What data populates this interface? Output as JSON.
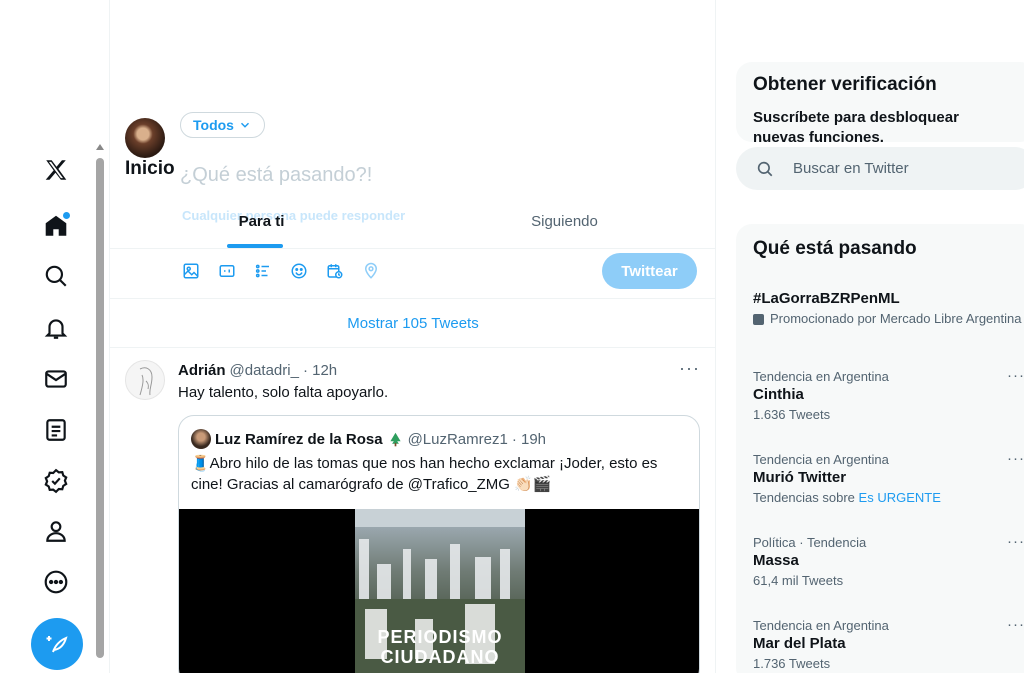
{
  "nav": {
    "items": [
      "x-logo",
      "home",
      "explore",
      "notifications",
      "messages",
      "lists",
      "verified",
      "profile",
      "more"
    ]
  },
  "header": {
    "title": "Inicio",
    "audience": "Todos",
    "compose_placeholder": "¿Qué está pasando?!",
    "reply_setting": "Cualquier persona puede responder",
    "tabs": [
      {
        "label": "Para ti",
        "active": true
      },
      {
        "label": "Siguiendo",
        "active": false
      }
    ],
    "tweet_button": "Twittear"
  },
  "feed": {
    "show_more": "Mostrar 105 Tweets",
    "tweet": {
      "name": "Adrián",
      "handle": "@datadri_",
      "time": "· 12h",
      "text": "Hay talento, solo falta apoyarlo.",
      "quote": {
        "name": "Luz Ramírez de la Rosa",
        "handle": "@LuzRamrez1",
        "time": "· 19h",
        "text": "🧵Abro hilo de las tomas que nos han hecho exclamar ¡Joder, esto es cine! Gracias al camarógrafo de @Trafico_ZMG 👏🏻🎬",
        "media_title": "PERIODISMO CIUDADANO"
      }
    }
  },
  "sidebar": {
    "verify_title": "Obtener verificación",
    "verify_text": "Suscríbete para desbloquear nuevas funciones.",
    "search_placeholder": "Buscar en Twitter",
    "trends_title": "Qué está pasando",
    "trends": [
      {
        "context": "",
        "name": "#LaGorraBZRPenML",
        "count": "Promocionado por Mercado Libre Argentina",
        "promoted": true
      },
      {
        "context": "Tendencia en Argentina",
        "name": "Cinthia",
        "count": "1.636 Tweets"
      },
      {
        "context": "Tendencia en Argentina",
        "name": "Murió Twitter",
        "count": "Tendencias sobre",
        "link": "Es URGENTE"
      },
      {
        "context": "Política · Tendencia",
        "name": "Massa",
        "count": "61,4 mil Tweets"
      },
      {
        "context": "Tendencia en Argentina",
        "name": "Mar del Plata",
        "count": "1.736 Tweets"
      }
    ]
  },
  "colors": {
    "accent": "#1d9bf0",
    "text": "#0f1419",
    "muted": "#536471"
  }
}
